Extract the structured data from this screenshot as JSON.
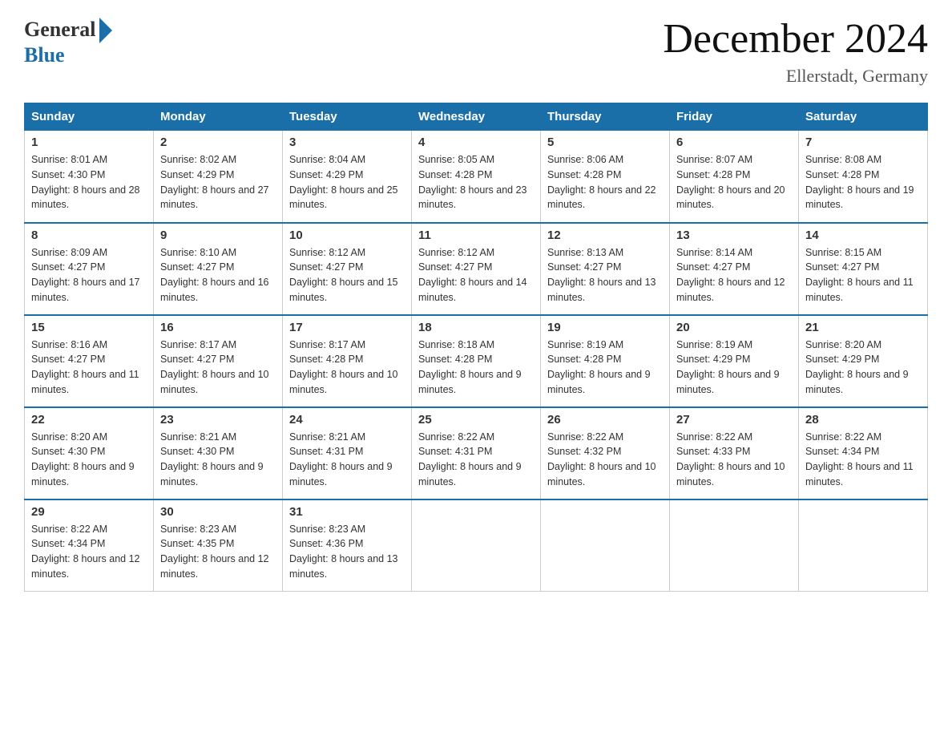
{
  "header": {
    "logo_general": "General",
    "logo_blue": "Blue",
    "title": "December 2024",
    "subtitle": "Ellerstadt, Germany"
  },
  "days_of_week": [
    "Sunday",
    "Monday",
    "Tuesday",
    "Wednesday",
    "Thursday",
    "Friday",
    "Saturday"
  ],
  "weeks": [
    [
      {
        "day": "1",
        "sunrise": "8:01 AM",
        "sunset": "4:30 PM",
        "daylight": "8 hours and 28 minutes."
      },
      {
        "day": "2",
        "sunrise": "8:02 AM",
        "sunset": "4:29 PM",
        "daylight": "8 hours and 27 minutes."
      },
      {
        "day": "3",
        "sunrise": "8:04 AM",
        "sunset": "4:29 PM",
        "daylight": "8 hours and 25 minutes."
      },
      {
        "day": "4",
        "sunrise": "8:05 AM",
        "sunset": "4:28 PM",
        "daylight": "8 hours and 23 minutes."
      },
      {
        "day": "5",
        "sunrise": "8:06 AM",
        "sunset": "4:28 PM",
        "daylight": "8 hours and 22 minutes."
      },
      {
        "day": "6",
        "sunrise": "8:07 AM",
        "sunset": "4:28 PM",
        "daylight": "8 hours and 20 minutes."
      },
      {
        "day": "7",
        "sunrise": "8:08 AM",
        "sunset": "4:28 PM",
        "daylight": "8 hours and 19 minutes."
      }
    ],
    [
      {
        "day": "8",
        "sunrise": "8:09 AM",
        "sunset": "4:27 PM",
        "daylight": "8 hours and 17 minutes."
      },
      {
        "day": "9",
        "sunrise": "8:10 AM",
        "sunset": "4:27 PM",
        "daylight": "8 hours and 16 minutes."
      },
      {
        "day": "10",
        "sunrise": "8:12 AM",
        "sunset": "4:27 PM",
        "daylight": "8 hours and 15 minutes."
      },
      {
        "day": "11",
        "sunrise": "8:12 AM",
        "sunset": "4:27 PM",
        "daylight": "8 hours and 14 minutes."
      },
      {
        "day": "12",
        "sunrise": "8:13 AM",
        "sunset": "4:27 PM",
        "daylight": "8 hours and 13 minutes."
      },
      {
        "day": "13",
        "sunrise": "8:14 AM",
        "sunset": "4:27 PM",
        "daylight": "8 hours and 12 minutes."
      },
      {
        "day": "14",
        "sunrise": "8:15 AM",
        "sunset": "4:27 PM",
        "daylight": "8 hours and 11 minutes."
      }
    ],
    [
      {
        "day": "15",
        "sunrise": "8:16 AM",
        "sunset": "4:27 PM",
        "daylight": "8 hours and 11 minutes."
      },
      {
        "day": "16",
        "sunrise": "8:17 AM",
        "sunset": "4:27 PM",
        "daylight": "8 hours and 10 minutes."
      },
      {
        "day": "17",
        "sunrise": "8:17 AM",
        "sunset": "4:28 PM",
        "daylight": "8 hours and 10 minutes."
      },
      {
        "day": "18",
        "sunrise": "8:18 AM",
        "sunset": "4:28 PM",
        "daylight": "8 hours and 9 minutes."
      },
      {
        "day": "19",
        "sunrise": "8:19 AM",
        "sunset": "4:28 PM",
        "daylight": "8 hours and 9 minutes."
      },
      {
        "day": "20",
        "sunrise": "8:19 AM",
        "sunset": "4:29 PM",
        "daylight": "8 hours and 9 minutes."
      },
      {
        "day": "21",
        "sunrise": "8:20 AM",
        "sunset": "4:29 PM",
        "daylight": "8 hours and 9 minutes."
      }
    ],
    [
      {
        "day": "22",
        "sunrise": "8:20 AM",
        "sunset": "4:30 PM",
        "daylight": "8 hours and 9 minutes."
      },
      {
        "day": "23",
        "sunrise": "8:21 AM",
        "sunset": "4:30 PM",
        "daylight": "8 hours and 9 minutes."
      },
      {
        "day": "24",
        "sunrise": "8:21 AM",
        "sunset": "4:31 PM",
        "daylight": "8 hours and 9 minutes."
      },
      {
        "day": "25",
        "sunrise": "8:22 AM",
        "sunset": "4:31 PM",
        "daylight": "8 hours and 9 minutes."
      },
      {
        "day": "26",
        "sunrise": "8:22 AM",
        "sunset": "4:32 PM",
        "daylight": "8 hours and 10 minutes."
      },
      {
        "day": "27",
        "sunrise": "8:22 AM",
        "sunset": "4:33 PM",
        "daylight": "8 hours and 10 minutes."
      },
      {
        "day": "28",
        "sunrise": "8:22 AM",
        "sunset": "4:34 PM",
        "daylight": "8 hours and 11 minutes."
      }
    ],
    [
      {
        "day": "29",
        "sunrise": "8:22 AM",
        "sunset": "4:34 PM",
        "daylight": "8 hours and 12 minutes."
      },
      {
        "day": "30",
        "sunrise": "8:23 AM",
        "sunset": "4:35 PM",
        "daylight": "8 hours and 12 minutes."
      },
      {
        "day": "31",
        "sunrise": "8:23 AM",
        "sunset": "4:36 PM",
        "daylight": "8 hours and 13 minutes."
      },
      null,
      null,
      null,
      null
    ]
  ]
}
